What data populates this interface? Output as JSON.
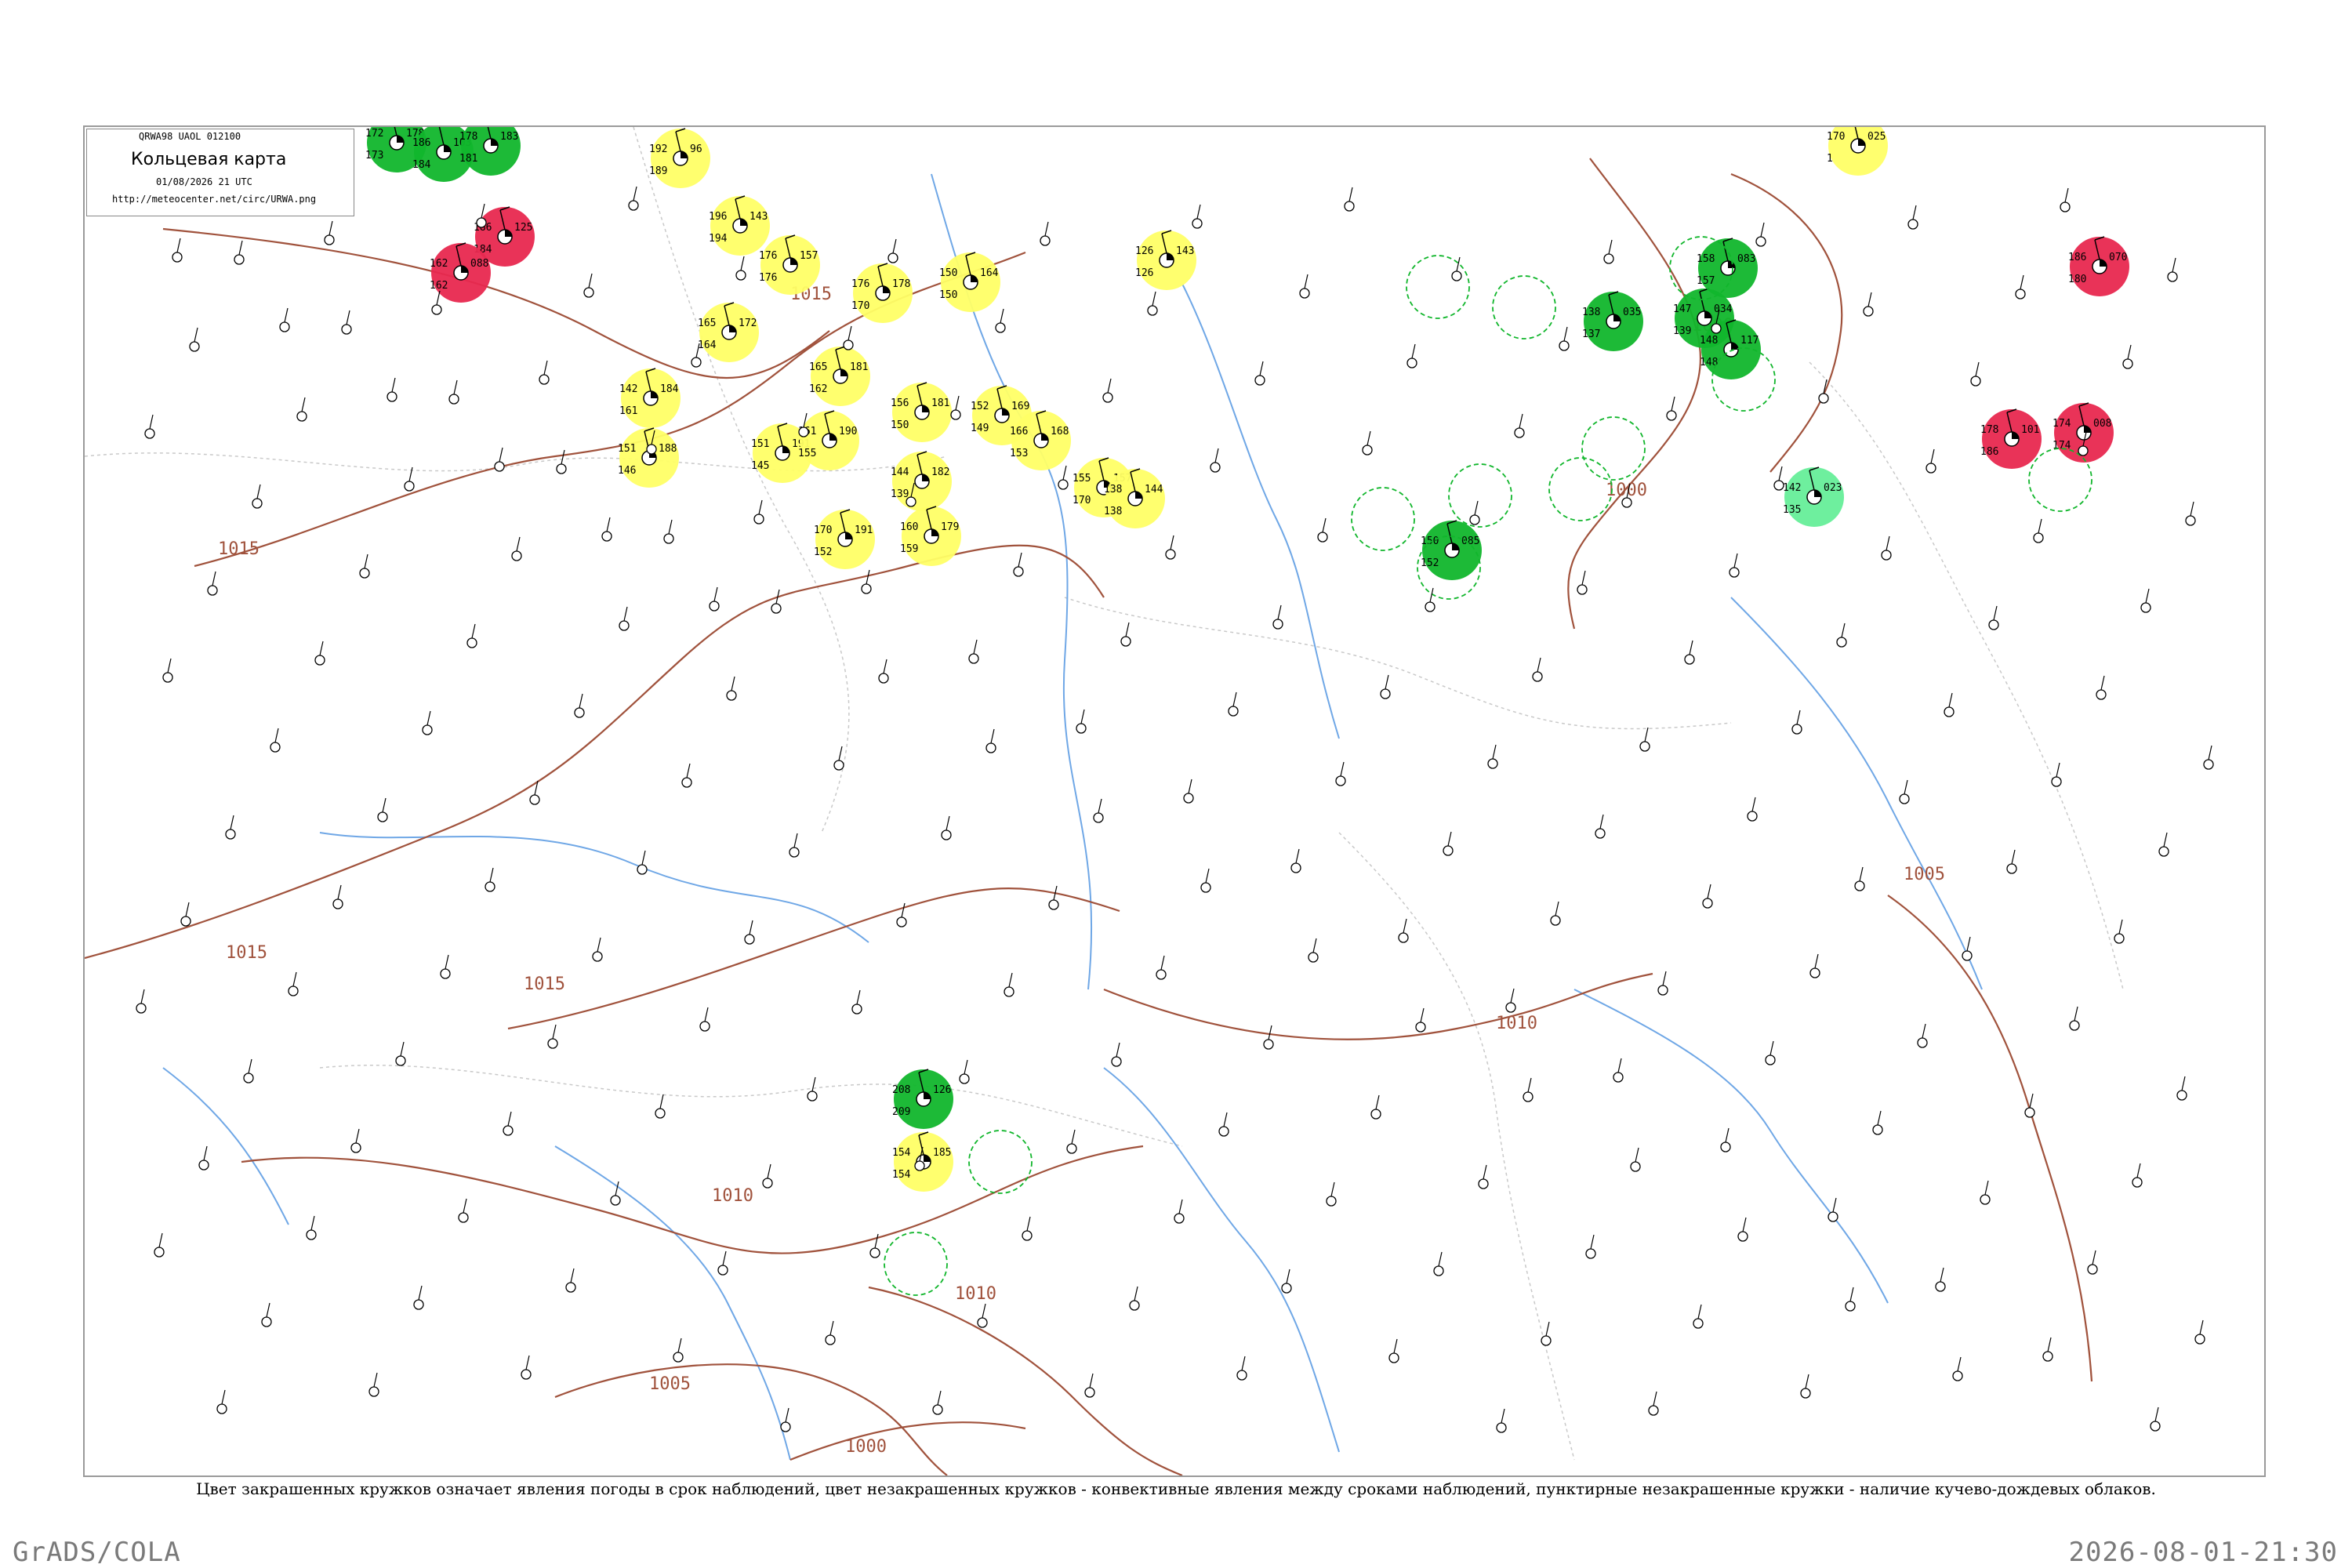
{
  "header": {
    "code": "QRWA98  UAOL  012100",
    "title": "Кольцевая карта",
    "datetime": "01/08/2026 21 UTC",
    "url": "http://meteocenter.net/circ/URWA.png"
  },
  "caption": "Цвет закрашенных кружков означает явления погоды в срок наблюдений, цвет незакрашенных кружков - конвективные явления между сроками наблюдений, пунктирные незакрашенные кружки - наличие кучево-дождевых облаков.",
  "footer": {
    "left": "GrADS/COLA",
    "right": "2026-08-01-21:30"
  },
  "colors": {
    "rain": "#11b62c",
    "thunderstorm": "#e8284f",
    "fog_haze": "#ffff66",
    "shower_light": "#66ee99",
    "isobar": "#a0523c",
    "river": "#6fa7e6",
    "border": "#c9c9c9",
    "station": "#000000"
  },
  "isobars": [
    {
      "label": "1015"
    },
    {
      "label": "1015"
    },
    {
      "label": "1015"
    },
    {
      "label": "1015"
    },
    {
      "label": "1010"
    },
    {
      "label": "1010"
    },
    {
      "label": "1010"
    },
    {
      "label": "1005"
    },
    {
      "label": "1005"
    },
    {
      "label": "1000"
    },
    {
      "label": "1000"
    },
    {
      "label": "1000"
    }
  ],
  "stations": [
    {
      "t": "172",
      "p": "178",
      "d": "173",
      "weather": "rain"
    },
    {
      "t": "186",
      "p": "103",
      "d": "184",
      "weather": "rain"
    },
    {
      "t": "178",
      "p": "183",
      "d": "181",
      "weather": "rain"
    },
    {
      "t": "186",
      "p": "125",
      "d": "184",
      "weather": "thunderstorm"
    },
    {
      "t": "192",
      "p": "96",
      "d": "189",
      "weather": "fog_haze"
    },
    {
      "t": "196",
      "p": "143",
      "d": "194",
      "weather": "fog_haze"
    },
    {
      "t": "176",
      "p": "157",
      "d": "176",
      "weather": "fog_haze"
    },
    {
      "t": "165",
      "p": "172",
      "d": "164",
      "weather": "fog_haze"
    },
    {
      "t": "165",
      "p": "181",
      "d": "162",
      "weather": "fog_haze"
    },
    {
      "t": "176",
      "p": "178",
      "d": "170",
      "weather": "fog_haze"
    },
    {
      "t": "150",
      "p": "164",
      "d": "150",
      "weather": "fog_haze"
    },
    {
      "t": "142",
      "p": "184",
      "d": "161",
      "weather": "fog_haze"
    },
    {
      "t": "151",
      "p": "188",
      "d": "146",
      "weather": "fog_haze"
    },
    {
      "t": "151",
      "p": "191",
      "d": "145",
      "weather": "fog_haze"
    },
    {
      "t": "161",
      "p": "190",
      "d": "155",
      "weather": "fog_haze"
    },
    {
      "t": "156",
      "p": "181",
      "d": "150",
      "weather": "fog_haze"
    },
    {
      "t": "144",
      "p": "182",
      "d": "139",
      "weather": "fog_haze"
    },
    {
      "t": "160",
      "p": "179",
      "d": "159",
      "weather": "fog_haze"
    },
    {
      "t": "170",
      "p": "191",
      "d": "152",
      "weather": "fog_haze"
    },
    {
      "t": "152",
      "p": "169",
      "d": "149",
      "weather": "fog_haze"
    },
    {
      "t": "166",
      "p": "168",
      "d": "153",
      "weather": "fog_haze"
    },
    {
      "t": "155",
      "p": "157",
      "d": "170",
      "weather": "fog_haze"
    },
    {
      "t": "138",
      "p": "144",
      "d": "138",
      "weather": "fog_haze"
    },
    {
      "t": "126",
      "p": "143",
      "d": "126",
      "weather": "fog_haze"
    },
    {
      "t": "154",
      "p": "185",
      "d": "154",
      "weather": "fog_haze"
    },
    {
      "t": "170",
      "p": "025",
      "d": "1",
      "weather": "fog_haze"
    },
    {
      "t": "138",
      "p": "035",
      "d": "137",
      "weather": "rain"
    },
    {
      "t": "147",
      "p": "034",
      "d": "139",
      "weather": "rain"
    },
    {
      "t": "148",
      "p": "117",
      "d": "148",
      "weather": "rain"
    },
    {
      "t": "158",
      "p": "083",
      "d": "157",
      "weather": "rain"
    },
    {
      "t": "150",
      "p": "085",
      "d": "152",
      "weather": "rain"
    },
    {
      "t": "208",
      "p": "126",
      "d": "209",
      "weather": "rain"
    },
    {
      "t": "186",
      "p": "070",
      "d": "180",
      "weather": "thunderstorm"
    },
    {
      "t": "174",
      "p": "008",
      "d": "174",
      "weather": "thunderstorm"
    },
    {
      "t": "162",
      "p": "088",
      "d": "162",
      "weather": "thunderstorm"
    },
    {
      "t": "178",
      "p": "101",
      "d": "186",
      "weather": "thunderstorm"
    },
    {
      "t": "142",
      "p": "023",
      "d": "135",
      "weather": "shower_light"
    }
  ]
}
